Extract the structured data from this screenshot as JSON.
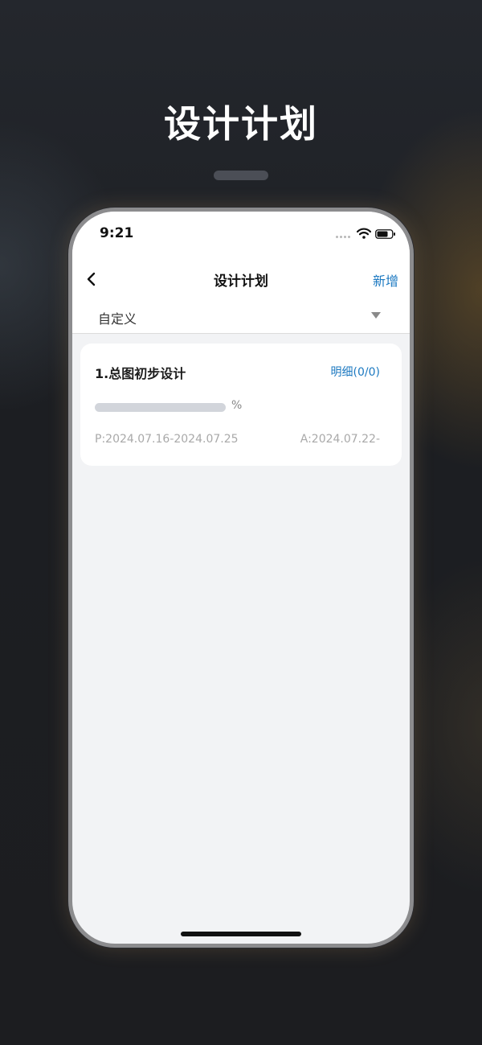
{
  "headline": "设计计划",
  "status_bar": {
    "time": "9:21"
  },
  "navbar": {
    "title": "设计计划",
    "action": "新增"
  },
  "filter": {
    "selected": "自定义"
  },
  "plans": [
    {
      "title": "1.总图初步设计",
      "detail_link": "明细(0/0)",
      "progress_percent": 0,
      "progress_label": "%",
      "plan_dates": "P:2024.07.16-2024.07.25",
      "actual_dates": "A:2024.07.22-"
    }
  ],
  "colors": {
    "accent": "#1c79c1",
    "screen_background": "#f2f3f5",
    "progress_track": "#d2d5db",
    "muted_text": "#a9a9a9"
  },
  "icons": [
    "back-icon",
    "wifi-icon",
    "battery-icon",
    "dropdown-caret-icon",
    "signal-icon"
  ]
}
